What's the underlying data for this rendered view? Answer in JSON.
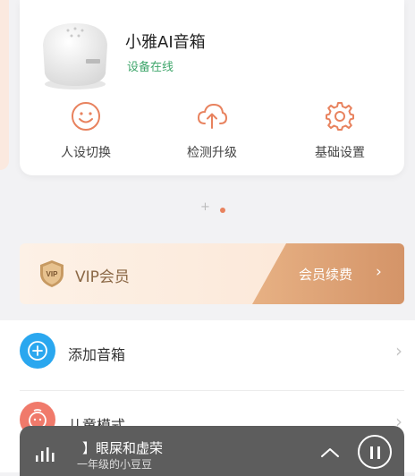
{
  "device": {
    "name": "小雅AI音箱",
    "status": "设备在线",
    "status_color": "#3fa66b"
  },
  "actions": [
    {
      "label": "人设切换",
      "icon": "smile-icon"
    },
    {
      "label": "检测升级",
      "icon": "cloud-upload-icon"
    },
    {
      "label": "基础设置",
      "icon": "gear-icon"
    }
  ],
  "pager": {
    "count": 2,
    "active": 2
  },
  "vip": {
    "badge_text": "VIP",
    "title": "VIP会员",
    "renew_label": "会员续费",
    "arrow": "›",
    "accent": "#d9a070"
  },
  "list": [
    {
      "label": "添加音箱",
      "icon": "plus-circle-icon",
      "color": "#2aa7ef"
    },
    {
      "label": "儿童模式",
      "icon": "child-mode-icon",
      "color": "#f07a6b"
    }
  ],
  "player": {
    "song": "】眼屎和虚荣",
    "artist": "一年级的小豆豆"
  },
  "brand_color": "#e8825e"
}
